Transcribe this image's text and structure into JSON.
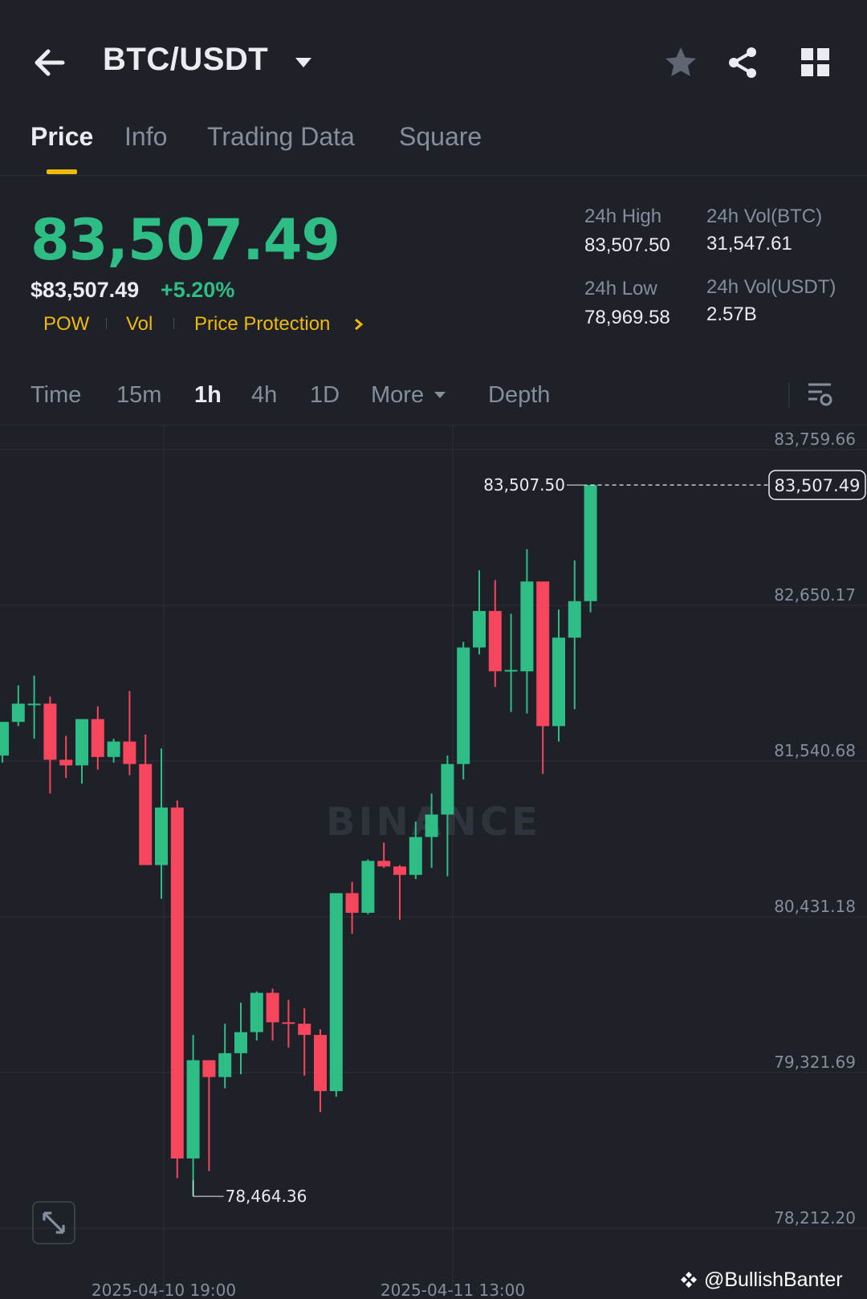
{
  "header": {
    "pair": "BTC/USDT",
    "icons": [
      "back-arrow-icon",
      "chevron-down-icon",
      "star-icon",
      "share-icon",
      "grid-icon"
    ]
  },
  "tabs": [
    {
      "label": "Price",
      "active": true
    },
    {
      "label": "Info",
      "active": false
    },
    {
      "label": "Trading Data",
      "active": false
    },
    {
      "label": "Square",
      "active": false
    }
  ],
  "price": {
    "last": "83,507.49",
    "usd": "$83,507.49",
    "change_pct": "+5.20%",
    "tags": [
      "POW",
      "Vol",
      "Price Protection"
    ]
  },
  "stats": {
    "high_label": "24h High",
    "high_value": "83,507.50",
    "low_label": "24h Low",
    "low_value": "78,969.58",
    "vol_btc_label": "24h Vol(BTC)",
    "vol_btc_value": "31,547.61",
    "vol_usdt_label": "24h Vol(USDT)",
    "vol_usdt_value": "2.57B"
  },
  "toolbar": {
    "items": [
      "Time",
      "15m",
      "1h",
      "4h",
      "1D",
      "More",
      "Depth"
    ],
    "active": "1h"
  },
  "colors": {
    "up": "#2ebd85",
    "down": "#f6465d",
    "accent": "#f0b90b",
    "bg": "#1f2129"
  },
  "chart_data": {
    "type": "candlestick",
    "interval": "1h",
    "y_ticks": [
      "83,759.66",
      "82,650.17",
      "81,540.68",
      "80,431.18",
      "79,321.69",
      "78,212.20"
    ],
    "x_ticks": [
      "2025-04-10 19:00",
      "2025-04-11 13:00"
    ],
    "ylim": [
      78212.2,
      83759.66
    ],
    "current_price_label": "83,507.49",
    "high_marker": "83,507.50",
    "low_marker": "78,464.36",
    "watermark": "BINANCE",
    "candles": [
      {
        "o": 81580,
        "h": 81810,
        "l": 81530,
        "c": 81820
      },
      {
        "o": 81820,
        "h": 82080,
        "l": 81790,
        "c": 81950
      },
      {
        "o": 81950,
        "h": 82150,
        "l": 81700,
        "c": 81950
      },
      {
        "o": 81950,
        "h": 82000,
        "l": 81310,
        "c": 81550
      },
      {
        "o": 81550,
        "h": 81720,
        "l": 81420,
        "c": 81510
      },
      {
        "o": 81510,
        "h": 81830,
        "l": 81380,
        "c": 81840
      },
      {
        "o": 81840,
        "h": 81930,
        "l": 81480,
        "c": 81570
      },
      {
        "o": 81570,
        "h": 81700,
        "l": 81530,
        "c": 81680
      },
      {
        "o": 81680,
        "h": 82040,
        "l": 81440,
        "c": 81520
      },
      {
        "o": 81520,
        "h": 81730,
        "l": 81320,
        "c": 80800
      },
      {
        "o": 80800,
        "h": 81630,
        "l": 80560,
        "c": 81210
      },
      {
        "o": 81210,
        "h": 81260,
        "l": 78570,
        "c": 78710
      },
      {
        "o": 78710,
        "h": 79590,
        "l": 78440,
        "c": 79410
      },
      {
        "o": 79410,
        "h": 79410,
        "l": 78620,
        "c": 79290
      },
      {
        "o": 79290,
        "h": 79670,
        "l": 79210,
        "c": 79460
      },
      {
        "o": 79460,
        "h": 79820,
        "l": 79310,
        "c": 79610
      },
      {
        "o": 79610,
        "h": 79900,
        "l": 79550,
        "c": 79890
      },
      {
        "o": 79890,
        "h": 79920,
        "l": 79550,
        "c": 79680
      },
      {
        "o": 79680,
        "h": 79840,
        "l": 79500,
        "c": 79670
      },
      {
        "o": 79670,
        "h": 79780,
        "l": 79300,
        "c": 79590
      },
      {
        "o": 79590,
        "h": 79630,
        "l": 79040,
        "c": 79190
      },
      {
        "o": 79190,
        "h": 80600,
        "l": 79150,
        "c": 80600
      },
      {
        "o": 80600,
        "h": 80680,
        "l": 80310,
        "c": 80460
      },
      {
        "o": 80460,
        "h": 80840,
        "l": 80450,
        "c": 80830
      },
      {
        "o": 80830,
        "h": 80960,
        "l": 80780,
        "c": 80790
      },
      {
        "o": 80790,
        "h": 80800,
        "l": 80410,
        "c": 80730
      },
      {
        "o": 80730,
        "h": 81110,
        "l": 80700,
        "c": 81000
      },
      {
        "o": 81000,
        "h": 81310,
        "l": 80780,
        "c": 81160
      },
      {
        "o": 81160,
        "h": 81580,
        "l": 80720,
        "c": 81520
      },
      {
        "o": 81520,
        "h": 82390,
        "l": 81410,
        "c": 82350
      },
      {
        "o": 82350,
        "h": 82900,
        "l": 82300,
        "c": 82610
      },
      {
        "o": 82610,
        "h": 82830,
        "l": 82070,
        "c": 82180
      },
      {
        "o": 82180,
        "h": 82590,
        "l": 81890,
        "c": 82190
      },
      {
        "o": 82180,
        "h": 83050,
        "l": 81880,
        "c": 82820
      },
      {
        "o": 82820,
        "h": 82820,
        "l": 81450,
        "c": 81790
      },
      {
        "o": 81790,
        "h": 82620,
        "l": 81680,
        "c": 82420
      },
      {
        "o": 82420,
        "h": 82970,
        "l": 81910,
        "c": 82680
      },
      {
        "o": 82680,
        "h": 83507.5,
        "l": 82600,
        "c": 83507.49
      }
    ]
  },
  "watermark_text": "@BullishBanter"
}
